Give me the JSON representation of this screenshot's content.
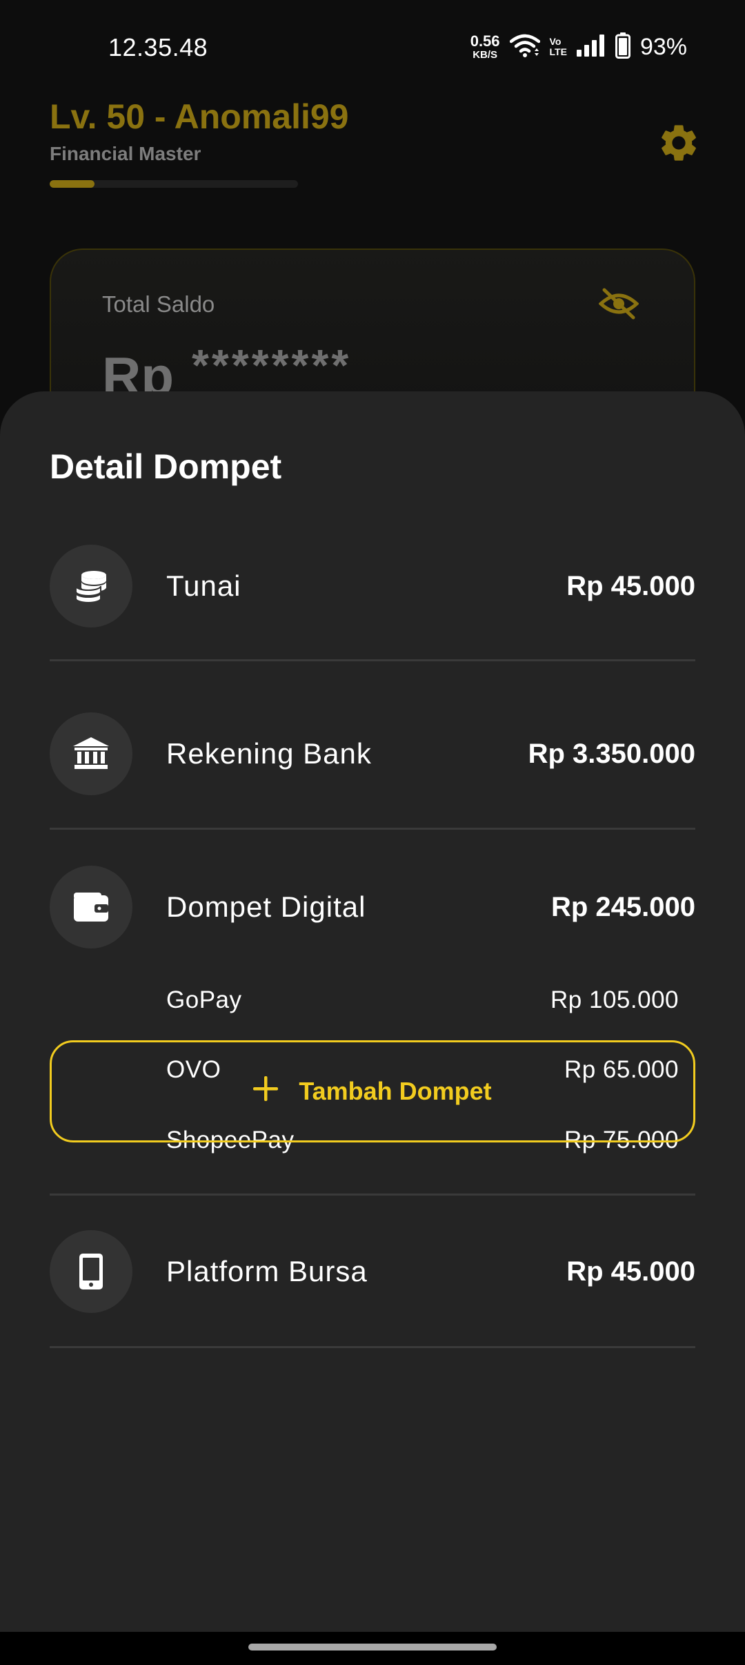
{
  "status_bar": {
    "time": "12.35.48",
    "net_speed_value": "0.56",
    "net_speed_unit": "KB/S",
    "volte_top": "Vo",
    "volte_bottom": "LTE",
    "battery": "93%",
    "icons": [
      "wifi-icon",
      "signal-icon",
      "battery-icon"
    ]
  },
  "header": {
    "title": "Lv. 50 - Anomali99",
    "subtitle": "Financial Master",
    "xp_progress": 0.18,
    "settings_icon": "gear-icon"
  },
  "balance_card": {
    "label": "Total Saldo",
    "prefix": "Rp",
    "masked_value": "********",
    "visibility_icon": "eye-off-icon"
  },
  "sheet": {
    "title": "Detail Dompet",
    "wallets": [
      {
        "name": "Tunai",
        "amount": "Rp 45.000",
        "icon": "coins-icon"
      },
      {
        "name": "Rekening Bank",
        "amount": "Rp 3.350.000",
        "icon": "bank-icon"
      },
      {
        "name": "Dompet Digital",
        "amount": "Rp 245.000",
        "icon": "wallet-icon",
        "sub_accounts": [
          {
            "name": "GoPay",
            "amount": "Rp 105.000"
          },
          {
            "name": "OVO",
            "amount": "Rp 65.000"
          },
          {
            "name": "ShopeePay",
            "amount": "Rp 75.000"
          }
        ]
      },
      {
        "name": "Platform Bursa",
        "amount": "Rp 45.000",
        "icon": "smartphone-icon"
      }
    ],
    "add_button_label": "Tambah Dompet"
  },
  "colors": {
    "accent": "#f2cc1f",
    "header_gold": "#8a7210",
    "sheet_bg": "#242424",
    "page_bg": "#0d0d0d"
  }
}
